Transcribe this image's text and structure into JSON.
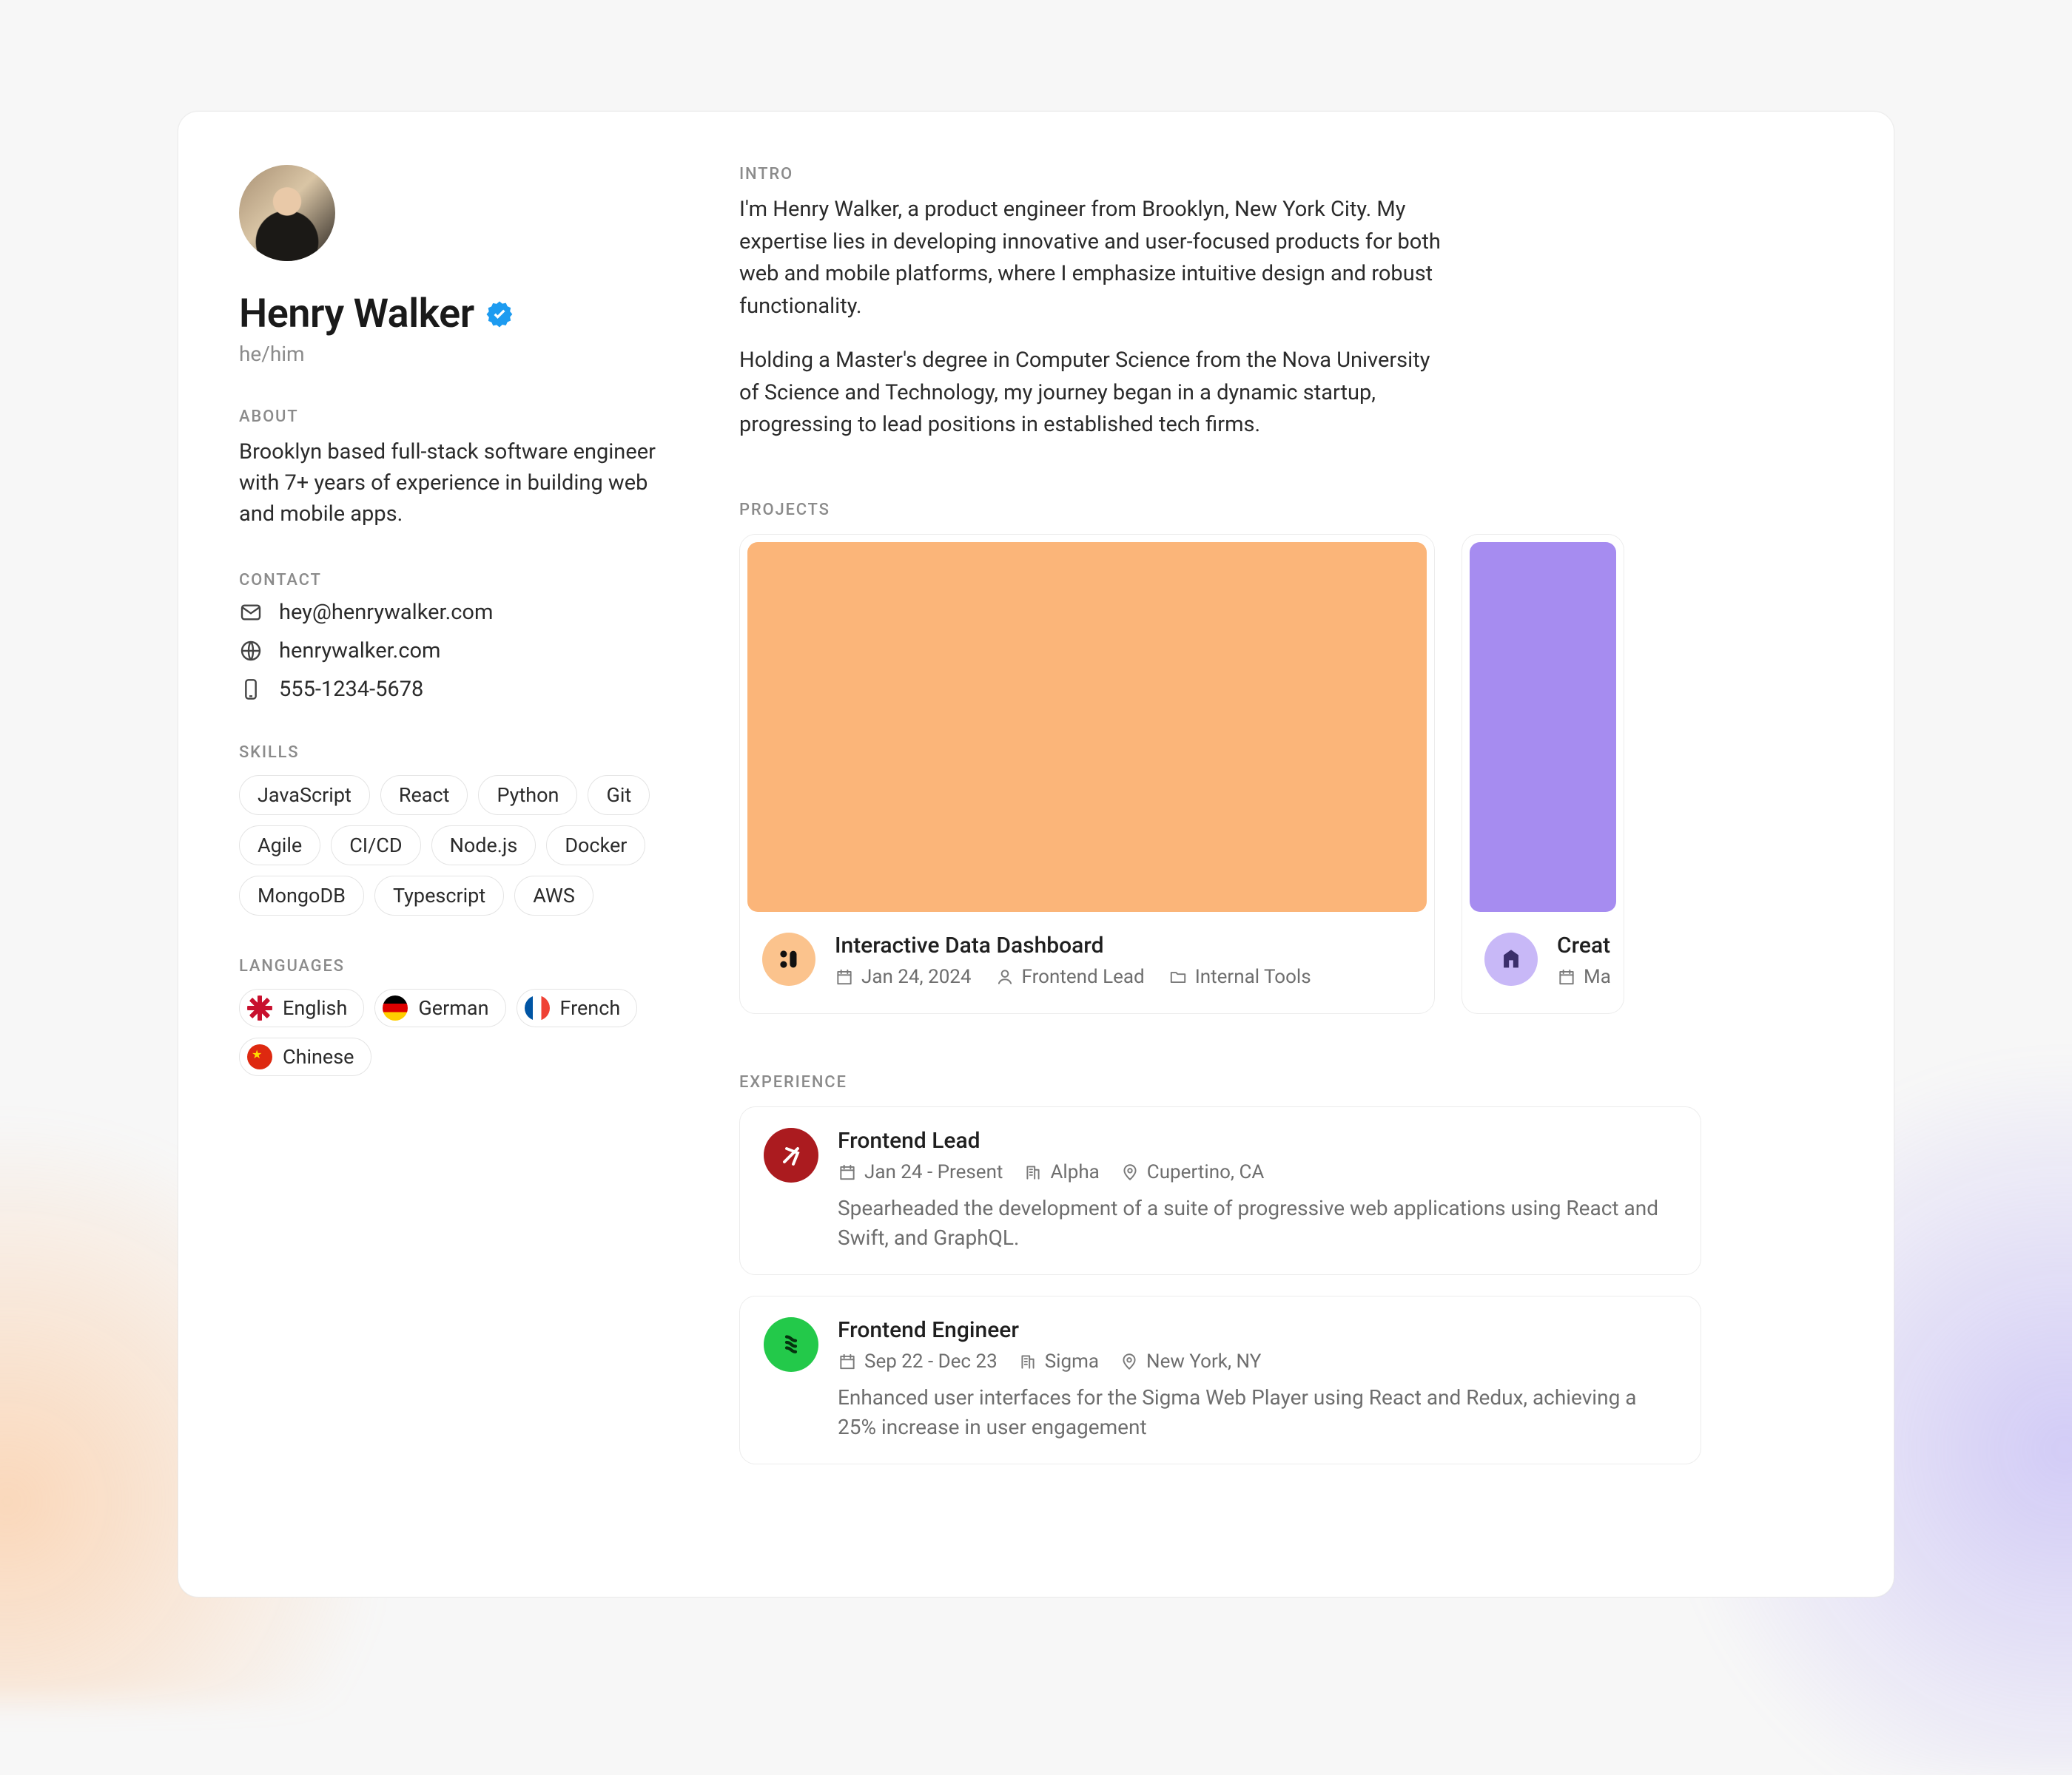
{
  "sidebar": {
    "name": "Henry Walker",
    "pronouns": "he/him",
    "about_label": "ABOUT",
    "about_text": "Brooklyn based full-stack software engineer with 7+ years of experience in building web and mobile apps.",
    "contact_label": "CONTACT",
    "contact": {
      "email": "hey@henrywalker.com",
      "website": "henrywalker.com",
      "phone": "555-1234-5678"
    },
    "skills_label": "SKILLS",
    "skills": [
      "JavaScript",
      "React",
      "Python",
      "Git",
      "Agile",
      "CI/CD",
      "Node.js",
      "Docker",
      "MongoDB",
      "Typescript",
      "AWS"
    ],
    "languages_label": "LANGUAGES",
    "languages": [
      {
        "name": "English",
        "flag": "uk"
      },
      {
        "name": "German",
        "flag": "de"
      },
      {
        "name": "French",
        "flag": "fr"
      },
      {
        "name": "Chinese",
        "flag": "cn"
      }
    ]
  },
  "main": {
    "intro_label": "INTRO",
    "intro_p1": "I'm Henry Walker, a product engineer from Brooklyn, New York City. My expertise lies in developing innovative and user-focused products for both web and mobile platforms, where I emphasize intuitive design and robust functionality.",
    "intro_p2": "Holding a Master's degree in Computer Science from the Nova University of Science and Technology, my journey began in a dynamic startup, progressing to lead positions in established tech firms.",
    "projects_label": "PROJECTS",
    "projects": [
      {
        "title": "Interactive Data Dashboard",
        "date": "Jan 24, 2024",
        "role": "Frontend Lead",
        "category": "Internal Tools",
        "hero": "orange",
        "icon": "orange"
      },
      {
        "title": "Creat",
        "date": "Ma",
        "role": "",
        "category": "",
        "hero": "purple",
        "icon": "purple"
      }
    ],
    "experience_label": "EXPERIENCE",
    "experience": [
      {
        "title": "Frontend Lead",
        "dates": "Jan 24 - Present",
        "company": "Alpha",
        "location": "Cupertino, CA",
        "desc": "Spearheaded the development of a suite of progressive web applications using React and Swift, and GraphQL.",
        "icon": "red"
      },
      {
        "title": "Frontend Engineer",
        "dates": "Sep 22 - Dec 23",
        "company": "Sigma",
        "location": "New York, NY",
        "desc": "Enhanced user interfaces for the Sigma Web Player using React and Redux, achieving a 25% increase in user engagement",
        "icon": "green"
      }
    ]
  }
}
